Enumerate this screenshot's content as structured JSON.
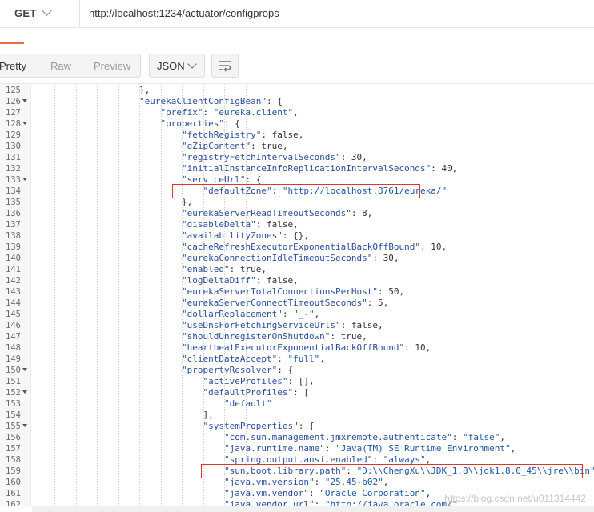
{
  "request": {
    "method": "GET",
    "url": "http://localhost:1234/actuator/configprops"
  },
  "toolbar": {
    "view_tabs": [
      "Pretty",
      "Raw",
      "Preview"
    ],
    "active_view": "Pretty",
    "format": "JSON"
  },
  "lines": [
    {
      "n": "125",
      "fold": false,
      "indent": 6,
      "text": "},"
    },
    {
      "n": "126",
      "fold": true,
      "indent": 6,
      "text": "\"eurekaClientConfigBean\": {"
    },
    {
      "n": "127",
      "fold": false,
      "indent": 7,
      "text": "\"prefix\": \"eureka.client\","
    },
    {
      "n": "128",
      "fold": true,
      "indent": 7,
      "text": "\"properties\": {"
    },
    {
      "n": "129",
      "fold": false,
      "indent": 8,
      "text": "\"fetchRegistry\": false,"
    },
    {
      "n": "130",
      "fold": false,
      "indent": 8,
      "text": "\"gZipContent\": true,"
    },
    {
      "n": "131",
      "fold": false,
      "indent": 8,
      "text": "\"registryFetchIntervalSeconds\": 30,"
    },
    {
      "n": "132",
      "fold": false,
      "indent": 8,
      "text": "\"initialInstanceInfoReplicationIntervalSeconds\": 40,"
    },
    {
      "n": "133",
      "fold": true,
      "indent": 8,
      "text": "\"serviceUrl\": {"
    },
    {
      "n": "134",
      "fold": false,
      "indent": 9,
      "text": "\"defaultZone\": \"http://localhost:8761/eureka/\""
    },
    {
      "n": "135",
      "fold": false,
      "indent": 8,
      "text": "},"
    },
    {
      "n": "136",
      "fold": false,
      "indent": 8,
      "text": "\"eurekaServerReadTimeoutSeconds\": 8,"
    },
    {
      "n": "137",
      "fold": false,
      "indent": 8,
      "text": "\"disableDelta\": false,"
    },
    {
      "n": "138",
      "fold": false,
      "indent": 8,
      "text": "\"availabilityZones\": {},"
    },
    {
      "n": "139",
      "fold": false,
      "indent": 8,
      "text": "\"cacheRefreshExecutorExponentialBackOffBound\": 10,"
    },
    {
      "n": "140",
      "fold": false,
      "indent": 8,
      "text": "\"eurekaConnectionIdleTimeoutSeconds\": 30,"
    },
    {
      "n": "141",
      "fold": false,
      "indent": 8,
      "text": "\"enabled\": true,"
    },
    {
      "n": "142",
      "fold": false,
      "indent": 8,
      "text": "\"logDeltaDiff\": false,"
    },
    {
      "n": "143",
      "fold": false,
      "indent": 8,
      "text": "\"eurekaServerTotalConnectionsPerHost\": 50,"
    },
    {
      "n": "144",
      "fold": false,
      "indent": 8,
      "text": "\"eurekaServerConnectTimeoutSeconds\": 5,"
    },
    {
      "n": "145",
      "fold": false,
      "indent": 8,
      "text": "\"dollarReplacement\": \"_-\","
    },
    {
      "n": "146",
      "fold": false,
      "indent": 8,
      "text": "\"useDnsForFetchingServiceUrls\": false,"
    },
    {
      "n": "147",
      "fold": false,
      "indent": 8,
      "text": "\"shouldUnregisterOnShutdown\": true,"
    },
    {
      "n": "148",
      "fold": false,
      "indent": 8,
      "text": "\"heartbeatExecutorExponentialBackOffBound\": 10,"
    },
    {
      "n": "149",
      "fold": false,
      "indent": 8,
      "text": "\"clientDataAccept\": \"full\","
    },
    {
      "n": "150",
      "fold": true,
      "indent": 8,
      "text": "\"propertyResolver\": {"
    },
    {
      "n": "151",
      "fold": false,
      "indent": 9,
      "text": "\"activeProfiles\": [],"
    },
    {
      "n": "152",
      "fold": true,
      "indent": 9,
      "text": "\"defaultProfiles\": ["
    },
    {
      "n": "153",
      "fold": false,
      "indent": 10,
      "text": "\"default\""
    },
    {
      "n": "154",
      "fold": false,
      "indent": 9,
      "text": "],"
    },
    {
      "n": "155",
      "fold": true,
      "indent": 9,
      "text": "\"systemProperties\": {"
    },
    {
      "n": "156",
      "fold": false,
      "indent": 10,
      "text": "\"com.sun.management.jmxremote.authenticate\": \"false\","
    },
    {
      "n": "157",
      "fold": false,
      "indent": 10,
      "text": "\"java.runtime.name\": \"Java(TM) SE Runtime Environment\","
    },
    {
      "n": "158",
      "fold": false,
      "indent": 10,
      "text": "\"spring.output.ansi.enabled\": \"always\","
    },
    {
      "n": "159",
      "fold": false,
      "indent": 10,
      "text": "\"sun.boot.library.path\": \"D:\\\\ChengXu\\\\JDK_1.8\\\\jdk1.8.0_45\\\\jre\\\\bin\","
    },
    {
      "n": "160",
      "fold": false,
      "indent": 10,
      "text": "\"java.vm.version\": \"25.45-b02\","
    },
    {
      "n": "161",
      "fold": false,
      "indent": 10,
      "text": "\"java.vm.vendor\": \"Oracle Corporation\","
    },
    {
      "n": "162",
      "fold": false,
      "indent": 10,
      "text": "\"java.vendor.url\": \"http://java.oracle.com/\","
    }
  ],
  "watermark": "https://blog.csdn.net/u011314442"
}
